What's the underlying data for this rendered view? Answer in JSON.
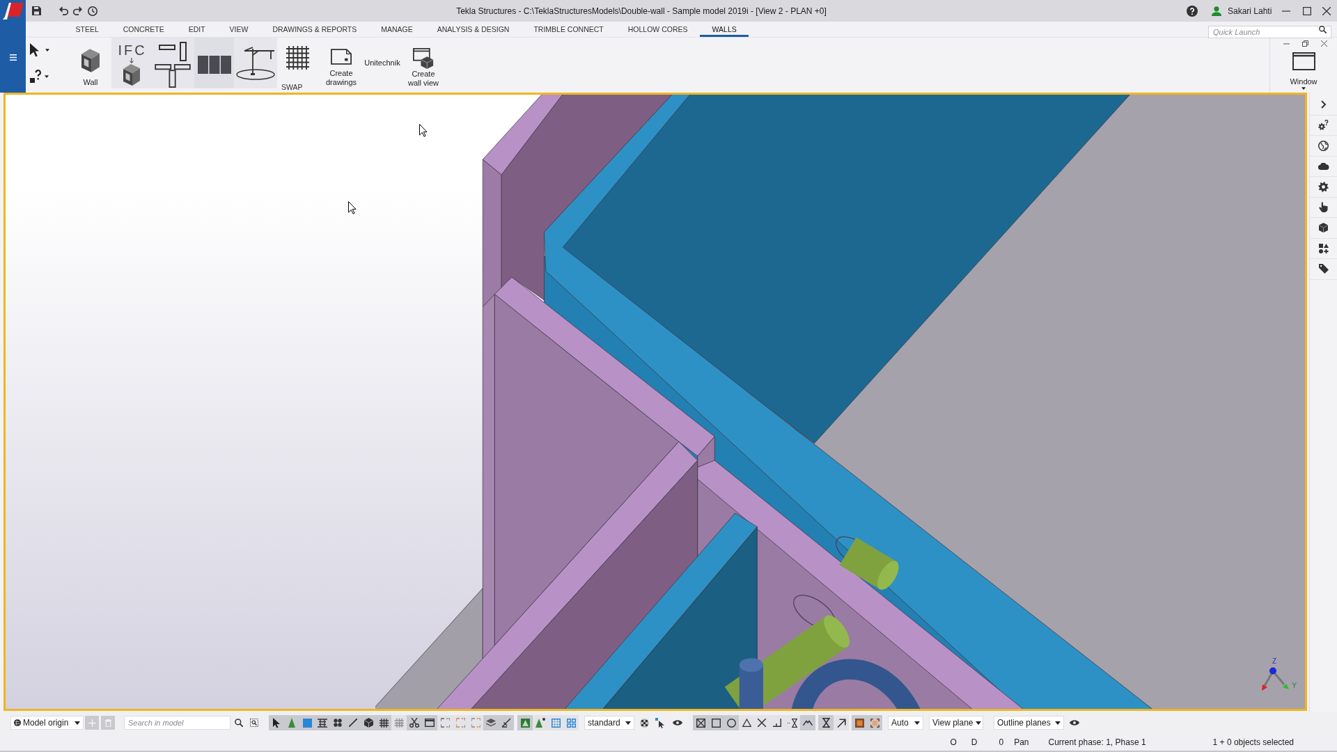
{
  "title_bar": {
    "title": "Tekla Structures - C:\\TeklaStructuresModels\\Double-wall - Sample model 2019i - [View 2 - PLAN +0]",
    "user_name": "Sakari Lahti"
  },
  "ribbon_tabs": [
    {
      "label": "STEEL",
      "selected": false
    },
    {
      "label": "CONCRETE",
      "selected": false
    },
    {
      "label": "EDIT",
      "selected": false
    },
    {
      "label": "VIEW",
      "selected": false
    },
    {
      "label": "DRAWINGS & REPORTS",
      "selected": false
    },
    {
      "label": "MANAGE",
      "selected": false
    },
    {
      "label": "ANALYSIS & DESIGN",
      "selected": false
    },
    {
      "label": "TRIMBLE CONNECT",
      "selected": false
    },
    {
      "label": "HOLLOW CORES",
      "selected": false
    },
    {
      "label": "WALLS",
      "selected": true
    }
  ],
  "quick_launch": {
    "placeholder": "Quick Launch"
  },
  "ribbon": {
    "wall": "Wall",
    "ifc": "IFC",
    "swap": "SWAP",
    "create_drawings": "Create drawings",
    "unitechnik": "Unitechnik",
    "create_wall_view": "Create wall view",
    "window": "Window"
  },
  "viewport": {
    "axis_labels": [
      "Z",
      "Y"
    ]
  },
  "bottom_toolbar": {
    "origin": "Model origin",
    "origin_buttons": [
      {
        "disabled": true
      },
      {
        "disabled": true
      }
    ],
    "search": {
      "placeholder": "Search in model"
    },
    "selection_switches": [
      {
        "on": true
      },
      {
        "on": true
      },
      {
        "on": true
      },
      {
        "on": true
      },
      {
        "on": true
      },
      {
        "on": true
      },
      {
        "on": true
      },
      {
        "on": true
      },
      {
        "on": false
      },
      {
        "on": true
      },
      {
        "on": true
      },
      {
        "on": false
      },
      {
        "on": false
      },
      {
        "on": false
      },
      {
        "on": true
      },
      {
        "on": true
      }
    ],
    "filter_switches": [
      {
        "on": true
      },
      {
        "on": false
      },
      {
        "on": false
      },
      {
        "on": false
      }
    ],
    "representation": "standard",
    "snap_switches": [
      {
        "on": true
      },
      {
        "on": true
      },
      {
        "on": true
      },
      {
        "on": false
      },
      {
        "on": false
      },
      {
        "on": false
      },
      {
        "on": false
      },
      {
        "on": true
      },
      {
        "on": true
      },
      {
        "on": false
      },
      {
        "on": true
      },
      {
        "on": true
      }
    ],
    "view_dropdowns": [
      "Auto",
      "View plane",
      "Outline planes"
    ]
  },
  "status_bar": {
    "indicators": [
      "O",
      "D",
      "0",
      "Pan"
    ],
    "phase": "Current phase: 1, Phase 1",
    "selection": "1 + 0 objects selected"
  }
}
